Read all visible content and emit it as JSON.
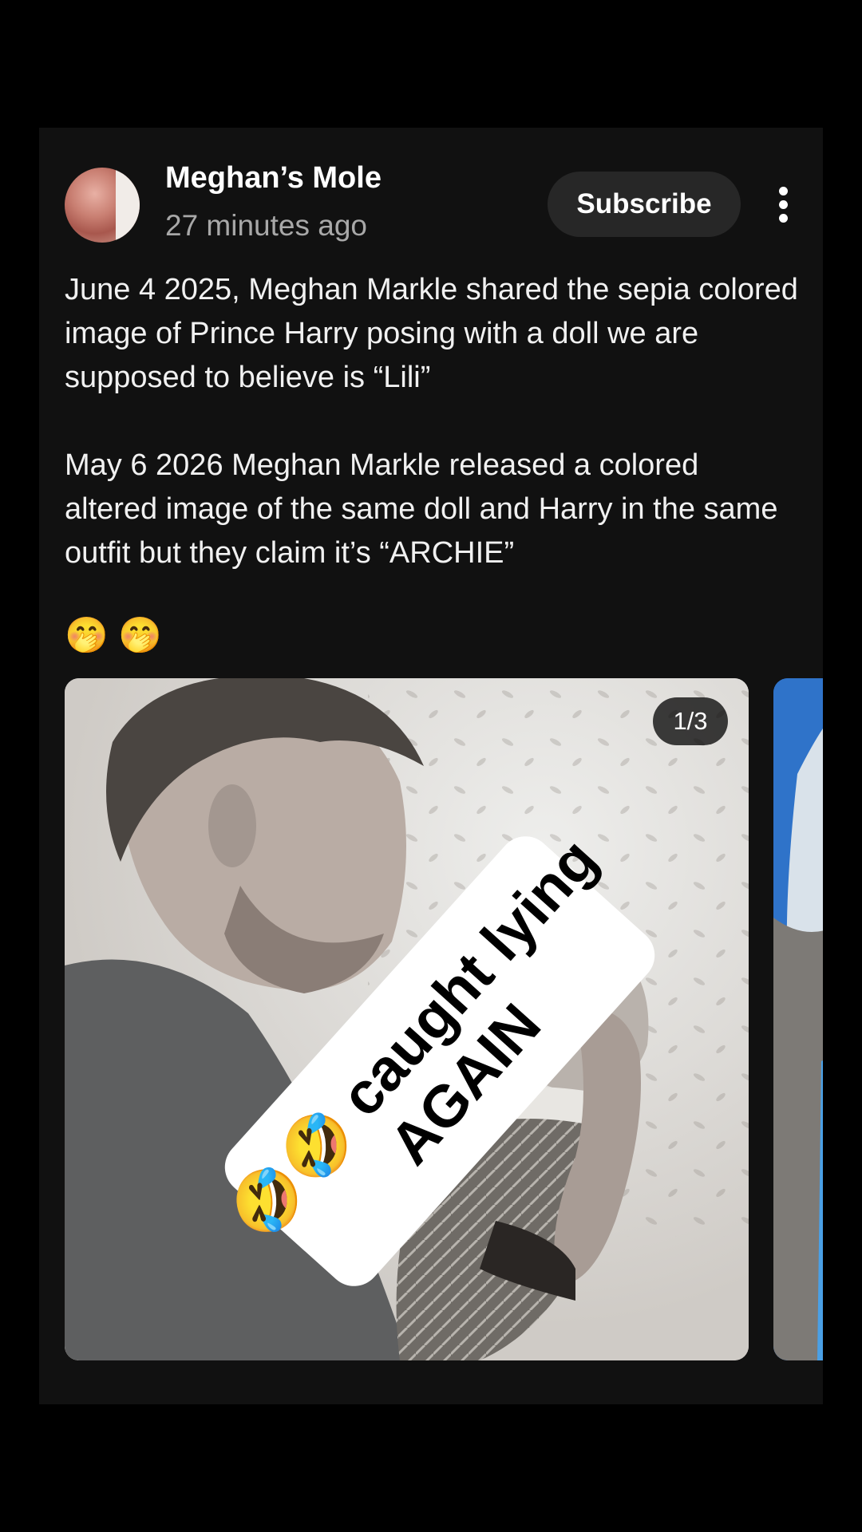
{
  "post": {
    "author": "Meghan’s Mole",
    "time": "27 minutes ago",
    "subscribe_label": "Subscribe",
    "text": "June 4 2025, Meghan Markle shared the sepia colored image of Prince Harry posing with a doll we are supposed to believe is “Lili”\n\nMay 6 2026 Meghan Markle released a colored altered image of the same doll and Harry in the same outfit but they claim it’s “ARCHIE”",
    "emojis": "🤭 🤭"
  },
  "carousel": {
    "counter": "1/3",
    "caption_line1": "🤣🤣 caught lying",
    "caption_line2": "AGAIN"
  },
  "icons": [
    "more-vert-icon"
  ]
}
